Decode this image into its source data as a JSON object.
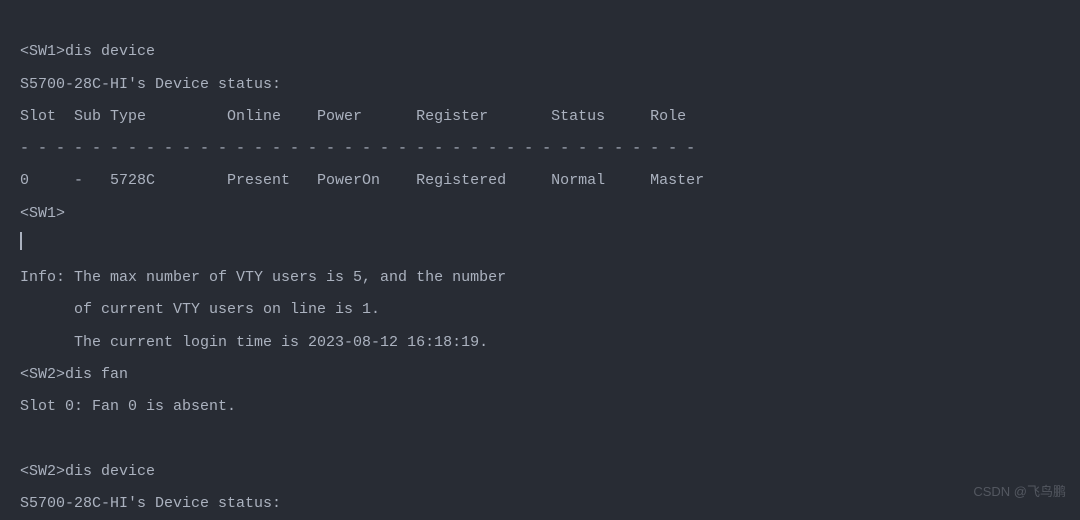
{
  "terminal": {
    "line1": "<SW1>dis device",
    "line2": "S5700-28C-HI's Device status:",
    "line3": "Slot  Sub Type         Online    Power      Register       Status     Role",
    "line4": "- - - - - - - - - - - - - - - - - - - - - - - - - - - - - - - - - - - - - -",
    "line5": "0     -   5728C        Present   PowerOn    Registered     Normal     Master",
    "line6": "<SW1>",
    "line7": "",
    "line8": "Info: The max number of VTY users is 5, and the number",
    "line9": "      of current VTY users on line is 1.",
    "line10": "      The current login time is 2023-08-12 16:18:19.",
    "line11": "<SW2>dis fan",
    "line12": "Slot 0: Fan 0 is absent.",
    "line13": "",
    "line14": "<SW2>dis device",
    "line15": "S5700-28C-HI's Device status:"
  },
  "watermark": "CSDN @飞鸟鹏"
}
